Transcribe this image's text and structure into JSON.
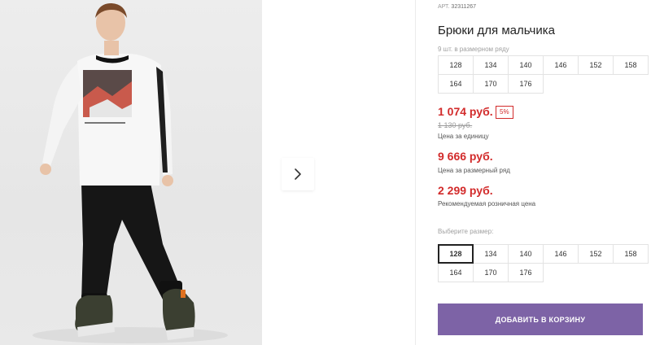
{
  "gallery": {
    "photo_alt": "Boy wearing black jogger pants, white long-sleeve shirt and sneakers",
    "next_icon": "chevron-right-icon"
  },
  "product": {
    "sku_label": "АРТ.",
    "sku": "32311267",
    "title": "Брюки для мальчика",
    "pack_note": "9 шт. в размерном ряду",
    "pack_sizes": [
      "128",
      "134",
      "140",
      "146",
      "152",
      "158",
      "164",
      "170",
      "176"
    ]
  },
  "pricing": {
    "unit_price": "1 074 руб.",
    "discount_badge": "5%",
    "old_price": "1 130 руб.",
    "unit_caption": "Цена за единицу",
    "pack_price": "9 666 руб.",
    "pack_caption": "Цена за размерный ряд",
    "retail_price": "2 299 руб.",
    "retail_caption": "Рекомендуемая розничная цена",
    "accent_color": "#d22b2b"
  },
  "size_select": {
    "label": "Выберите размер:",
    "options": [
      "128",
      "134",
      "140",
      "146",
      "152",
      "158",
      "164",
      "170",
      "176"
    ],
    "selected": "128"
  },
  "cart": {
    "add_label": "ДОБАВИТЬ В КОРЗИНУ",
    "button_color": "#7d63a6"
  }
}
